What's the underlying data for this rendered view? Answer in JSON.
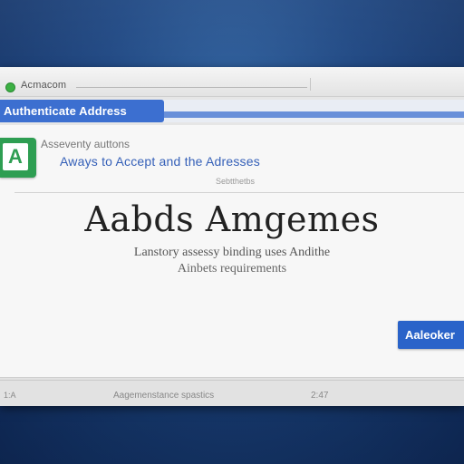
{
  "window": {
    "title": "Acmacom"
  },
  "tab": {
    "active_label": "Authenticate Address"
  },
  "header": {
    "logo_letter": "A",
    "breadcrumb": "Asseventy auttons",
    "subtitle": "Aways to Accept and the Adresses",
    "small_caption": "Sebtthetbs"
  },
  "main": {
    "headline": "Aabds Amgemes",
    "description_line_1": "Lanstory assessy binding uses Andithe",
    "description_line_2": "Ainbets requirements"
  },
  "actions": {
    "primary_label": "Aaleoker"
  },
  "statusbar": {
    "left": "1:A",
    "middle": "Aagemenstance spastics",
    "right": "2:47"
  }
}
